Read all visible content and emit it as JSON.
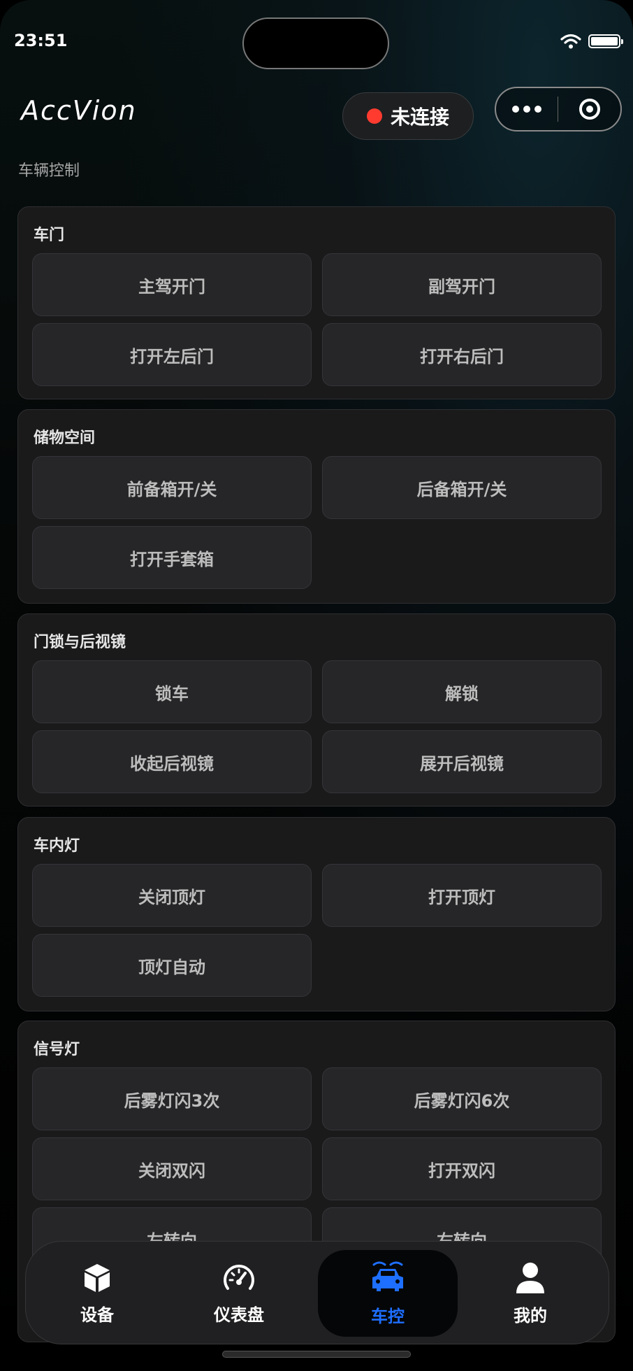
{
  "status_bar": {
    "time": "23:51"
  },
  "header": {
    "logo": "AccVion",
    "connection": {
      "label": "未连接",
      "color": "#ff3b30"
    }
  },
  "page_title": "车辆控制",
  "sections": [
    {
      "title": "车门",
      "buttons": [
        "主驾开门",
        "副驾开门",
        "打开左后门",
        "打开右后门"
      ]
    },
    {
      "title": "储物空间",
      "buttons": [
        "前备箱开/关",
        "后备箱开/关",
        "打开手套箱"
      ]
    },
    {
      "title": "门锁与后视镜",
      "buttons": [
        "锁车",
        "解锁",
        "收起后视镜",
        "展开后视镜"
      ]
    },
    {
      "title": "车内灯",
      "buttons": [
        "关闭顶灯",
        "打开顶灯",
        "顶灯自动"
      ]
    },
    {
      "title": "信号灯",
      "buttons": [
        "后雾灯闪3次",
        "后雾灯闪6次",
        "关闭双闪",
        "打开双闪",
        "左转向",
        "右转向"
      ]
    }
  ],
  "tabbar": {
    "active_color": "#1e6fff",
    "tabs": [
      {
        "label": "设备",
        "icon": "cube-icon"
      },
      {
        "label": "仪表盘",
        "icon": "speedometer-icon"
      },
      {
        "label": "车控",
        "icon": "car-icon",
        "active": true
      },
      {
        "label": "我的",
        "icon": "person-icon"
      }
    ]
  }
}
